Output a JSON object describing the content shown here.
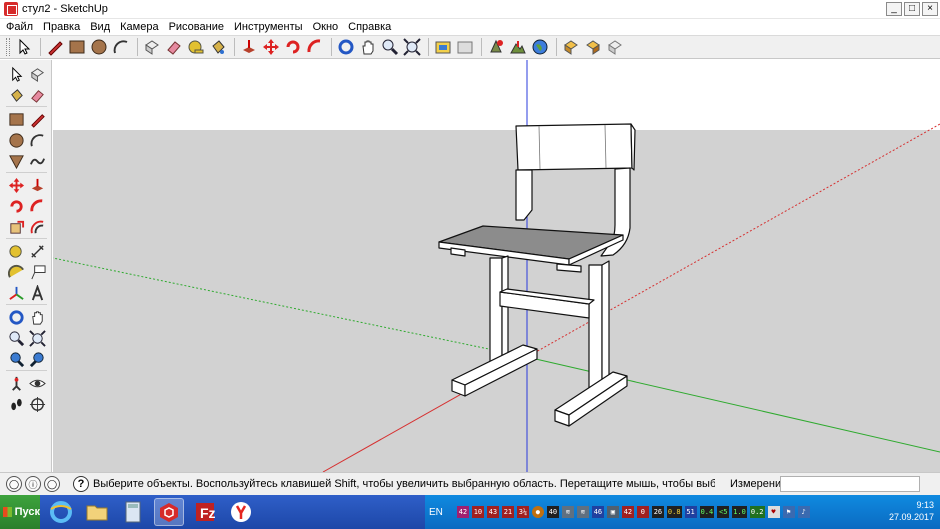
{
  "window": {
    "title": "стул2 - SketchUp",
    "controls": [
      "_",
      "□",
      "×"
    ]
  },
  "menu": [
    "Файл",
    "Правка",
    "Вид",
    "Камера",
    "Рисование",
    "Инструменты",
    "Окно",
    "Справка"
  ],
  "status": {
    "message": "Выберите объекты. Воспользуйтесь клавишей Shift, чтобы увеличить выбранную область. Перетащите мышь, чтобы выбрать несколько об",
    "measure_label": "Измерения",
    "measure_value": ""
  },
  "taskbar": {
    "start_label": "Пуск",
    "lang": "EN",
    "time": "9:13",
    "date": "27.09.2017",
    "tray_values": [
      "42",
      "10",
      "43",
      "21",
      "3¼",
      "40",
      "46",
      "42",
      "0",
      "26",
      "0.8",
      "51",
      "0.4",
      "<5",
      "1.0",
      "0.2"
    ]
  },
  "colors": {
    "sky": "#ffffff",
    "ground": "#d2d2d2",
    "axis_blue": "#2a3bdc",
    "axis_red": "#d63030",
    "axis_green": "#2faa2f",
    "chair_face": "#ffffff",
    "seat": "#8c8c8c"
  }
}
